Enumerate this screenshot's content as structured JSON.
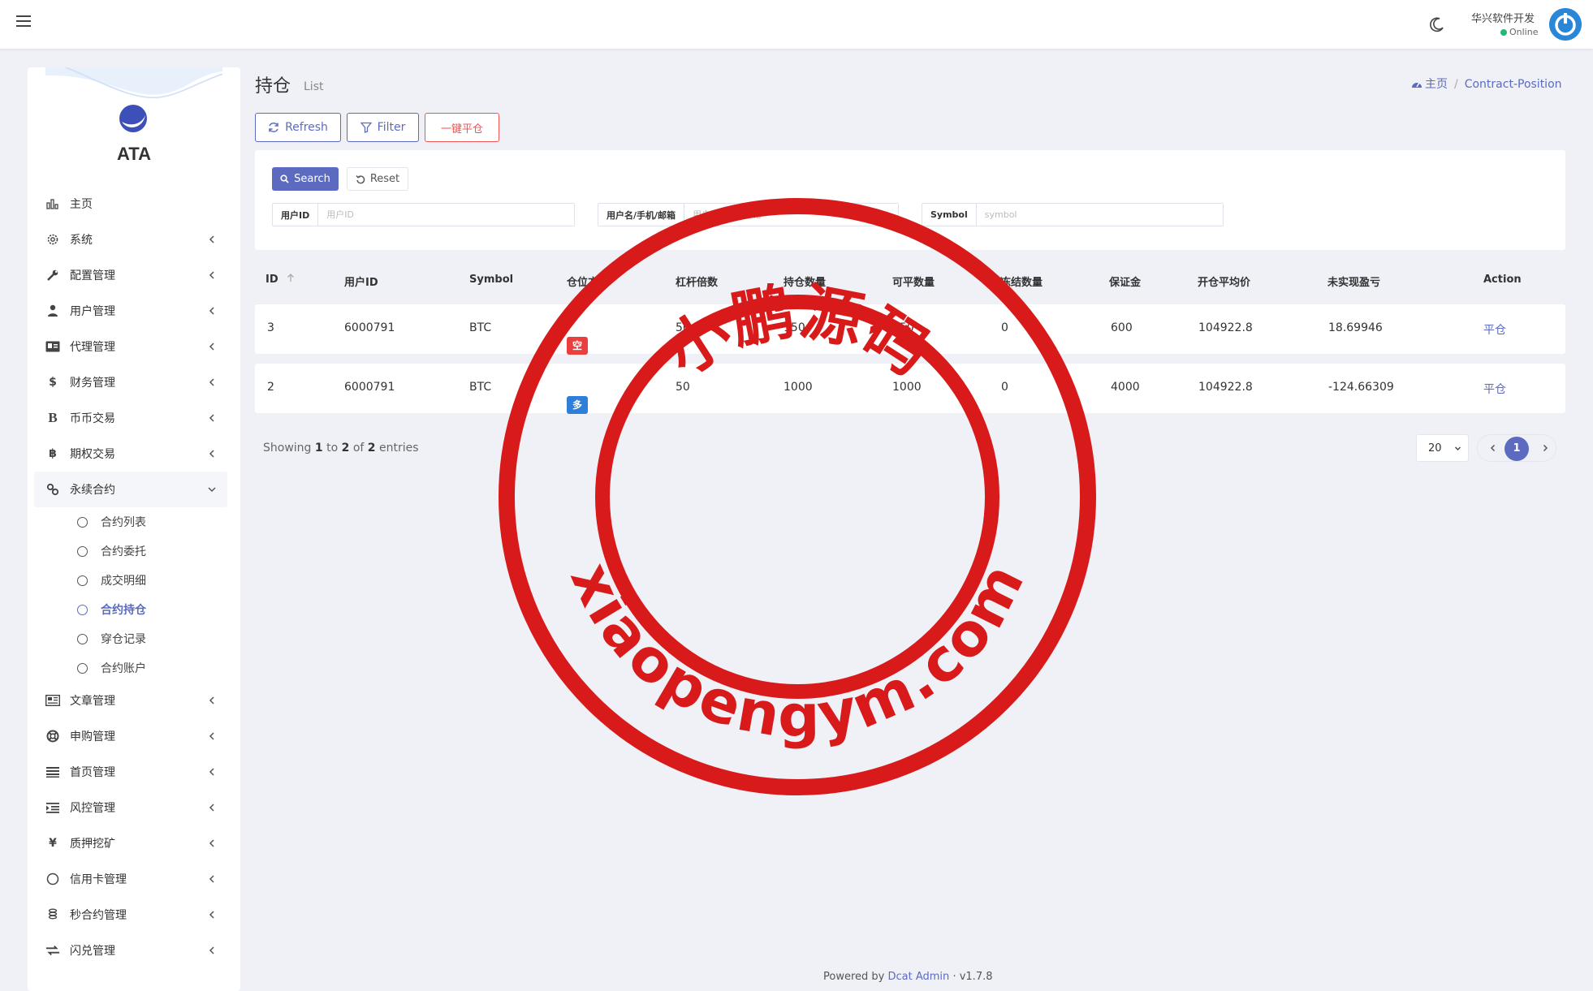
{
  "header": {
    "user_name": "华兴软件开发",
    "user_status": "Online",
    "accent_color": "#5c6bc0"
  },
  "sidebar": {
    "logo_text": "ATA",
    "items": [
      {
        "label": "主页",
        "icon": "bar-chart-icon"
      },
      {
        "label": "系统",
        "icon": "gear-icon"
      },
      {
        "label": "配置管理",
        "icon": "wrench-icon"
      },
      {
        "label": "用户管理",
        "icon": "user-tie-icon"
      },
      {
        "label": "代理管理",
        "icon": "id-card-icon"
      },
      {
        "label": "财务管理",
        "icon": "dollar-icon"
      },
      {
        "label": "币币交易",
        "icon": "bitcoin-b-icon"
      },
      {
        "label": "期权交易",
        "icon": "bitcoin-icon"
      },
      {
        "label": "永续合约",
        "icon": "link-icon"
      }
    ],
    "sub_items": [
      {
        "label": "合约列表"
      },
      {
        "label": "合约委托"
      },
      {
        "label": "成交明细"
      },
      {
        "label": "合约持仓"
      },
      {
        "label": "穿仓记录"
      },
      {
        "label": "合约账户"
      }
    ],
    "items_after": [
      {
        "label": "文章管理",
        "icon": "newspaper-icon"
      },
      {
        "label": "申购管理",
        "icon": "life-ring-icon"
      },
      {
        "label": "首页管理",
        "icon": "list-icon"
      },
      {
        "label": "风控管理",
        "icon": "indent-icon"
      },
      {
        "label": "质押挖矿",
        "icon": "yen-icon"
      },
      {
        "label": "信用卡管理",
        "icon": "circle-icon"
      },
      {
        "label": "秒合约管理",
        "icon": "coins-icon"
      },
      {
        "label": "闪兑管理",
        "icon": "exchange-icon"
      }
    ]
  },
  "page": {
    "title": "持仓",
    "subtitle": "List",
    "breadcrumb": [
      "主页",
      "Contract-Position"
    ]
  },
  "toolbar": {
    "refresh_label": "Refresh",
    "filter_label": "Filter",
    "close_all_label": "一键平仓"
  },
  "filter": {
    "search_label": "Search",
    "reset_label": "Reset",
    "fields": [
      {
        "label": "用户ID",
        "placeholder": "用户ID",
        "value": ""
      },
      {
        "label": "用户名/手机/邮箱",
        "placeholder": "用户名/手机/邮箱",
        "value": ""
      },
      {
        "label": "Symbol",
        "placeholder": "symbol",
        "value": ""
      }
    ]
  },
  "table": {
    "columns": [
      "ID",
      "用户ID",
      "Symbol",
      "仓位方向",
      "杠杆倍数",
      "持仓数量",
      "可平数量",
      "冻结数量",
      "保证金",
      "开仓平均价",
      "未实现盈亏",
      "Action"
    ],
    "rows": [
      {
        "id": "3",
        "user_id": "6000791",
        "symbol": "BTC",
        "direction": "空",
        "direction_color": "#e9403f",
        "leverage": "50",
        "quantity": "150",
        "closable": "150",
        "frozen": "0",
        "margin": "600",
        "avg_price": "104922.8",
        "pnl": "18.69946",
        "action": "平仓"
      },
      {
        "id": "2",
        "user_id": "6000791",
        "symbol": "BTC",
        "direction": "多",
        "direction_color": "#2d7fd9",
        "leverage": "50",
        "quantity": "1000",
        "closable": "1000",
        "frozen": "0",
        "margin": "4000",
        "avg_price": "104922.8",
        "pnl": "-124.66309",
        "action": "平仓"
      }
    ]
  },
  "pagination": {
    "showing_prefix": "Showing",
    "from": "1",
    "to_word": "to",
    "to": "2",
    "of_word": "of",
    "total": "2",
    "entries_word": "entries",
    "per_page": "20",
    "current_page": "1"
  },
  "footer": {
    "powered_by": "Powered by",
    "brand": "Dcat Admin",
    "separator": "·",
    "version": "v1.7.8"
  },
  "watermark": {
    "top_text": "小鹏源码",
    "bottom_text": "xiaopengym.com",
    "color": "#d91a1a"
  }
}
